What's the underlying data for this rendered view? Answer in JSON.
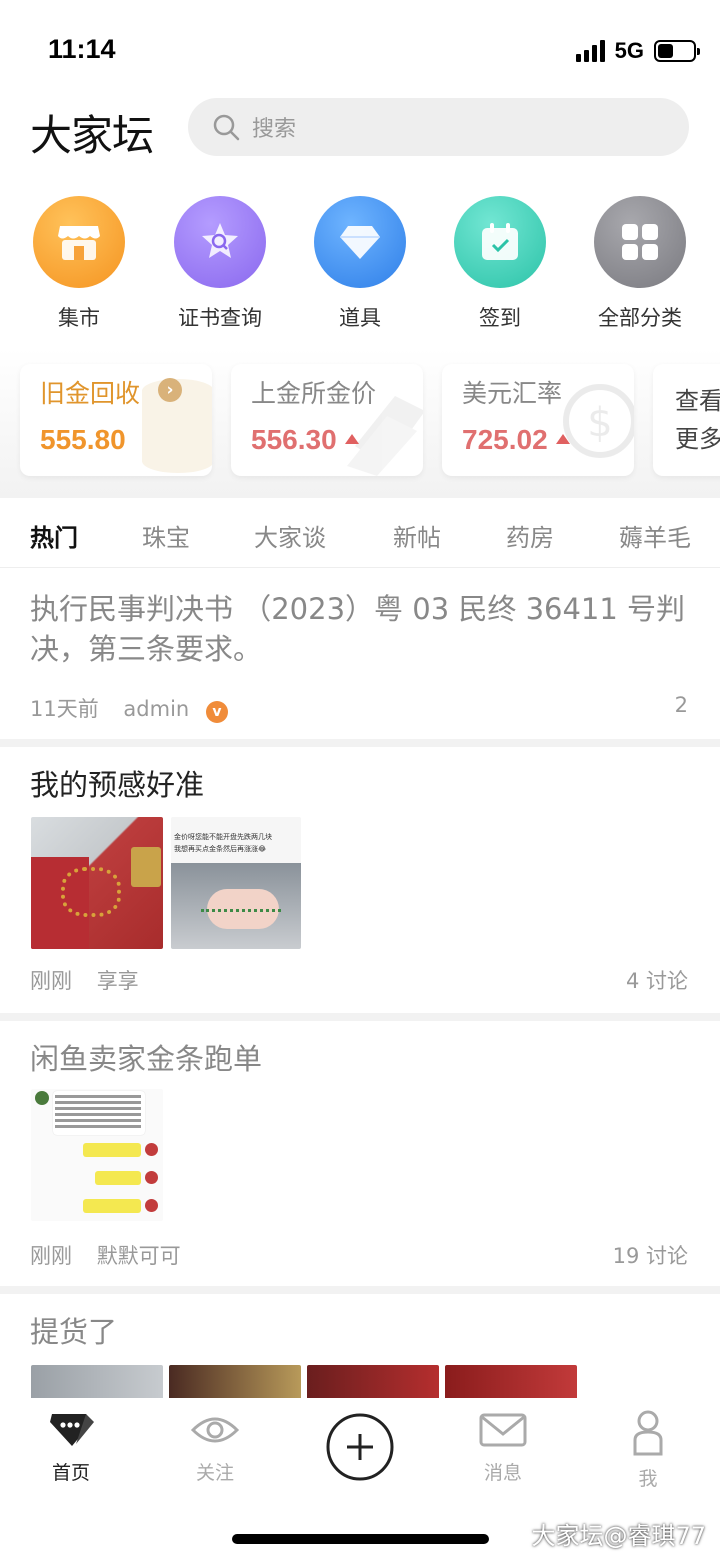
{
  "status_bar": {
    "time": "11:14",
    "network": "5G"
  },
  "header": {
    "logo": "大家坛",
    "search_placeholder": "搜索"
  },
  "shortcuts": [
    {
      "label": "集市",
      "icon": "store-icon",
      "color": "#f7a23a"
    },
    {
      "label": "证书查询",
      "icon": "certificate-search-icon",
      "color": "#9b7cf0"
    },
    {
      "label": "道具",
      "icon": "diamond-icon",
      "color": "#3f8ef0"
    },
    {
      "label": "签到",
      "icon": "calendar-check-icon",
      "color": "#3ed1b8"
    },
    {
      "label": "全部分类",
      "icon": "grid-icon",
      "color": "#8e8e93"
    }
  ],
  "prices": {
    "gold_recycle": {
      "title": "旧金回收",
      "value": "555.80",
      "color": "#f0952c"
    },
    "sge_gold": {
      "title": "上金所金价",
      "value": "556.30",
      "color": "#e07070"
    },
    "usd_rate": {
      "title": "美元汇率",
      "value": "725.02",
      "color": "#e07070"
    },
    "more": {
      "line1": "查看",
      "line2": "更多"
    }
  },
  "tabs": [
    "热门",
    "珠宝",
    "大家谈",
    "新帖",
    "药房",
    "薅羊毛"
  ],
  "posts": [
    {
      "title": "执行民事判决书 （2023）粤 03 民终 36411 号判决，第三条要求。",
      "time": "11天前",
      "author": "admin",
      "count": "2"
    },
    {
      "title": "我的预感好准",
      "time": "刚刚",
      "author": "享享",
      "count": "4 讨论",
      "thumb_text": "金价呀您能不能开盘先跌两几块\n我想再买点金条然后再涨涨😂"
    },
    {
      "title": "闲鱼卖家金条跑单",
      "time": "刚刚",
      "author": "默默可可",
      "count": "19 讨论"
    },
    {
      "title": "提货了"
    }
  ],
  "tabbar": [
    {
      "label": "首页",
      "icon": "home-icon",
      "active": true
    },
    {
      "label": "关注",
      "icon": "eye-icon"
    },
    {
      "label": "",
      "icon": "plus-icon"
    },
    {
      "label": "消息",
      "icon": "mail-icon"
    },
    {
      "label": "我",
      "icon": "person-icon"
    }
  ],
  "watermark": "大家坛@睿琪77"
}
